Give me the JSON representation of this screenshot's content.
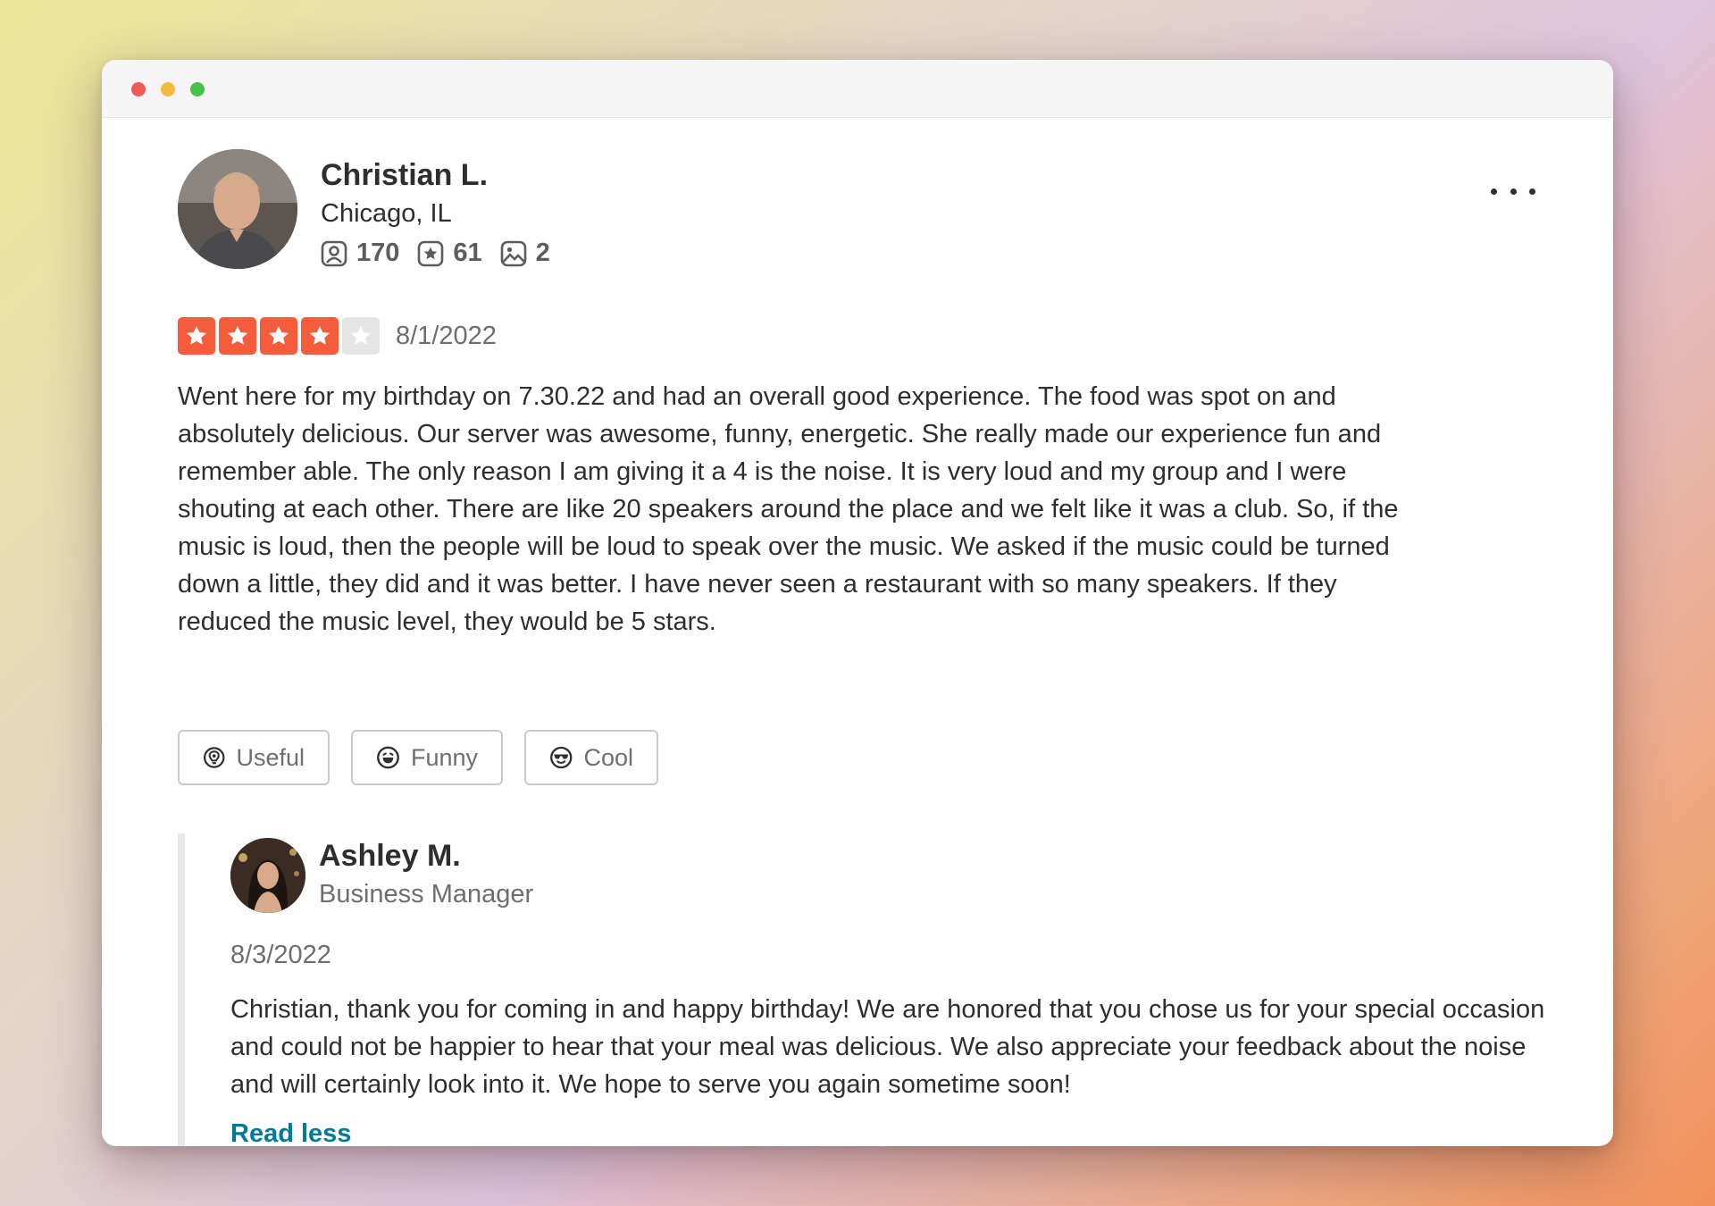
{
  "window": {
    "controls": [
      "close",
      "minimize",
      "maximize"
    ]
  },
  "review": {
    "author": {
      "name": "Christian L.",
      "location": "Chicago, IL",
      "stats": {
        "friends": "170",
        "reviews": "61",
        "photos": "2"
      }
    },
    "rating": 4,
    "rating_max": 5,
    "date": "8/1/2022",
    "text": "Went here for my birthday on 7.30.22 and had an overall good experience. The food was spot on and absolutely delicious. Our server was awesome, funny, energetic. She really made our experience fun and remember able. The only reason I am giving it a 4 is the noise. It is very loud and my group and I were shouting at each other. There are like 20 speakers around the place and we felt like it was a club. So, if the music is loud, then the people will be loud to speak over the music. We asked if the music could be turned down a little, they did and it was better. I have never seen a restaurant with so many speakers. If they reduced the music level, they would be 5 stars.",
    "reactions": {
      "useful": "Useful",
      "funny": "Funny",
      "cool": "Cool"
    }
  },
  "reply": {
    "name": "Ashley M.",
    "role": "Business Manager",
    "date": "8/3/2022",
    "text": "Christian, thank you for coming in and happy birthday! We are honored that you chose us for your special occasion and could not be happier to hear that your meal was delicious. We also appreciate your feedback about the noise and will certainly look into it. We hope to serve you again sometime soon!",
    "toggle_label": "Read less"
  },
  "colors": {
    "star_on": "#f55c3b",
    "star_off": "#e5e5e5",
    "link": "#027a97"
  }
}
